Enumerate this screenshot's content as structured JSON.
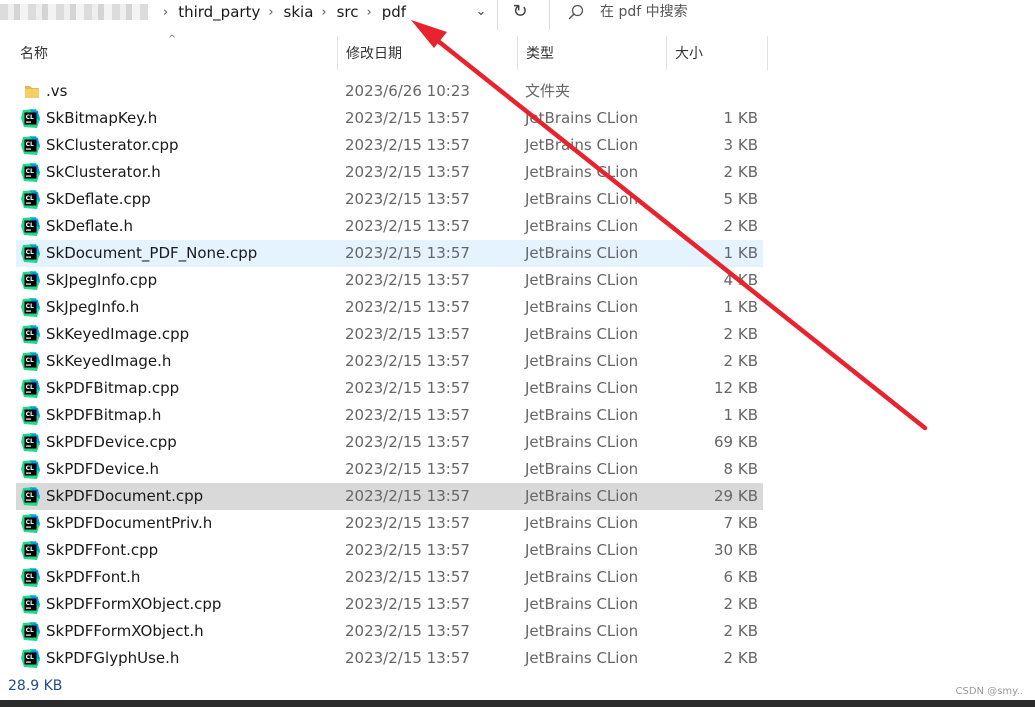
{
  "addressbar": {
    "breadcrumbs": [
      "third_party",
      "skia",
      "src",
      "pdf"
    ],
    "separator": "›",
    "dropdown_glyph": "⌄",
    "refresh_glyph": "↻",
    "search_placeholder": "在 pdf 中搜索",
    "search_icon": "search-icon"
  },
  "header": {
    "sort_glyph": "^",
    "columns": [
      "名称",
      "修改日期",
      "类型",
      "大小"
    ]
  },
  "files": [
    {
      "name": ".vs",
      "date": "2023/6/26 10:23",
      "type": "文件夹",
      "size": "",
      "icon": "folder-icon",
      "state": ""
    },
    {
      "name": "SkBitmapKey.h",
      "date": "2023/2/15 13:57",
      "type": "JetBrains CLion",
      "size": "1 KB",
      "icon": "clion-file-icon",
      "state": ""
    },
    {
      "name": "SkClusterator.cpp",
      "date": "2023/2/15 13:57",
      "type": "JetBrains CLion",
      "size": "3 KB",
      "icon": "clion-file-icon",
      "state": ""
    },
    {
      "name": "SkClusterator.h",
      "date": "2023/2/15 13:57",
      "type": "JetBrains CLion",
      "size": "2 KB",
      "icon": "clion-file-icon",
      "state": ""
    },
    {
      "name": "SkDeflate.cpp",
      "date": "2023/2/15 13:57",
      "type": "JetBrains CLion",
      "size": "5 KB",
      "icon": "clion-file-icon",
      "state": ""
    },
    {
      "name": "SkDeflate.h",
      "date": "2023/2/15 13:57",
      "type": "JetBrains CLion",
      "size": "2 KB",
      "icon": "clion-file-icon",
      "state": ""
    },
    {
      "name": "SkDocument_PDF_None.cpp",
      "date": "2023/2/15 13:57",
      "type": "JetBrains CLion",
      "size": "1 KB",
      "icon": "clion-file-icon",
      "state": "hover"
    },
    {
      "name": "SkJpegInfo.cpp",
      "date": "2023/2/15 13:57",
      "type": "JetBrains CLion",
      "size": "4 KB",
      "icon": "clion-file-icon",
      "state": ""
    },
    {
      "name": "SkJpegInfo.h",
      "date": "2023/2/15 13:57",
      "type": "JetBrains CLion",
      "size": "1 KB",
      "icon": "clion-file-icon",
      "state": ""
    },
    {
      "name": "SkKeyedImage.cpp",
      "date": "2023/2/15 13:57",
      "type": "JetBrains CLion",
      "size": "2 KB",
      "icon": "clion-file-icon",
      "state": ""
    },
    {
      "name": "SkKeyedImage.h",
      "date": "2023/2/15 13:57",
      "type": "JetBrains CLion",
      "size": "2 KB",
      "icon": "clion-file-icon",
      "state": ""
    },
    {
      "name": "SkPDFBitmap.cpp",
      "date": "2023/2/15 13:57",
      "type": "JetBrains CLion",
      "size": "12 KB",
      "icon": "clion-file-icon",
      "state": ""
    },
    {
      "name": "SkPDFBitmap.h",
      "date": "2023/2/15 13:57",
      "type": "JetBrains CLion",
      "size": "1 KB",
      "icon": "clion-file-icon",
      "state": ""
    },
    {
      "name": "SkPDFDevice.cpp",
      "date": "2023/2/15 13:57",
      "type": "JetBrains CLion",
      "size": "69 KB",
      "icon": "clion-file-icon",
      "state": ""
    },
    {
      "name": "SkPDFDevice.h",
      "date": "2023/2/15 13:57",
      "type": "JetBrains CLion",
      "size": "8 KB",
      "icon": "clion-file-icon",
      "state": ""
    },
    {
      "name": "SkPDFDocument.cpp",
      "date": "2023/2/15 13:57",
      "type": "JetBrains CLion",
      "size": "29 KB",
      "icon": "clion-file-icon",
      "state": "selected"
    },
    {
      "name": "SkPDFDocumentPriv.h",
      "date": "2023/2/15 13:57",
      "type": "JetBrains CLion",
      "size": "7 KB",
      "icon": "clion-file-icon",
      "state": ""
    },
    {
      "name": "SkPDFFont.cpp",
      "date": "2023/2/15 13:57",
      "type": "JetBrains CLion",
      "size": "30 KB",
      "icon": "clion-file-icon",
      "state": ""
    },
    {
      "name": "SkPDFFont.h",
      "date": "2023/2/15 13:57",
      "type": "JetBrains CLion",
      "size": "6 KB",
      "icon": "clion-file-icon",
      "state": ""
    },
    {
      "name": "SkPDFFormXObject.cpp",
      "date": "2023/2/15 13:57",
      "type": "JetBrains CLion",
      "size": "2 KB",
      "icon": "clion-file-icon",
      "state": ""
    },
    {
      "name": "SkPDFFormXObject.h",
      "date": "2023/2/15 13:57",
      "type": "JetBrains CLion",
      "size": "2 KB",
      "icon": "clion-file-icon",
      "state": ""
    },
    {
      "name": "SkPDFGlyphUse.h",
      "date": "2023/2/15 13:57",
      "type": "JetBrains CLion",
      "size": "2 KB",
      "icon": "clion-file-icon",
      "state": ""
    }
  ],
  "status": {
    "selection_size": "28.9 KB",
    "watermark": "CSDN @smy.."
  },
  "colors": {
    "hover_row": "#e5f3ff",
    "selected_row": "#d9d9d9",
    "annotation_arrow": "#e8232d",
    "status_text": "#1f4f82"
  }
}
